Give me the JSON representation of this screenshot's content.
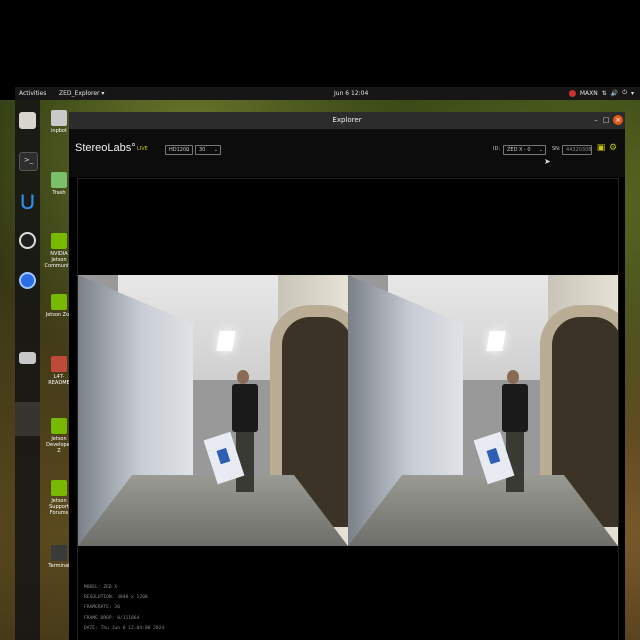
{
  "topbar": {
    "activities": "Activities",
    "app_menu": "ZED_Explorer ▾",
    "clock": "Jun 6 12:04",
    "power_mode": "MAXN"
  },
  "desktop_icons": [
    {
      "label": "inpbot",
      "color": "#c9c9c9"
    },
    {
      "label": "Trash",
      "color": "#7bbf6a"
    },
    {
      "label": "NVIDIA Jetson Community",
      "color": "#76b900"
    },
    {
      "label": "Jetson Zoo",
      "color": "#76b900"
    },
    {
      "label": "L4T-README",
      "color": "#c04a3a"
    },
    {
      "label": "Jetson Developer Z",
      "color": "#76b900"
    },
    {
      "label": "Jetson Support Forums",
      "color": "#76b900"
    },
    {
      "label": "Terminal",
      "color": "#3a3a3a"
    }
  ],
  "window": {
    "title": "Explorer",
    "min": "–",
    "max": "□",
    "close": "×"
  },
  "toolbar": {
    "brand": "StereoLabs°",
    "live_tag": "LIVE",
    "resolution": "HD1200",
    "fps": "30",
    "id_label": "ID:",
    "id_value": "ZED X - 0",
    "sn_label": "SN:",
    "sn_value": "44320308"
  },
  "info": {
    "model": "MODEL: ZED X",
    "resolution": "RESOLUTION: 3840 x 1200",
    "framerate": "FRAMERATE: 30",
    "frame_drop": "FRAME DROP: 0/111864",
    "date": "DATE: Thu Jun 6 12:04:00 2024"
  }
}
